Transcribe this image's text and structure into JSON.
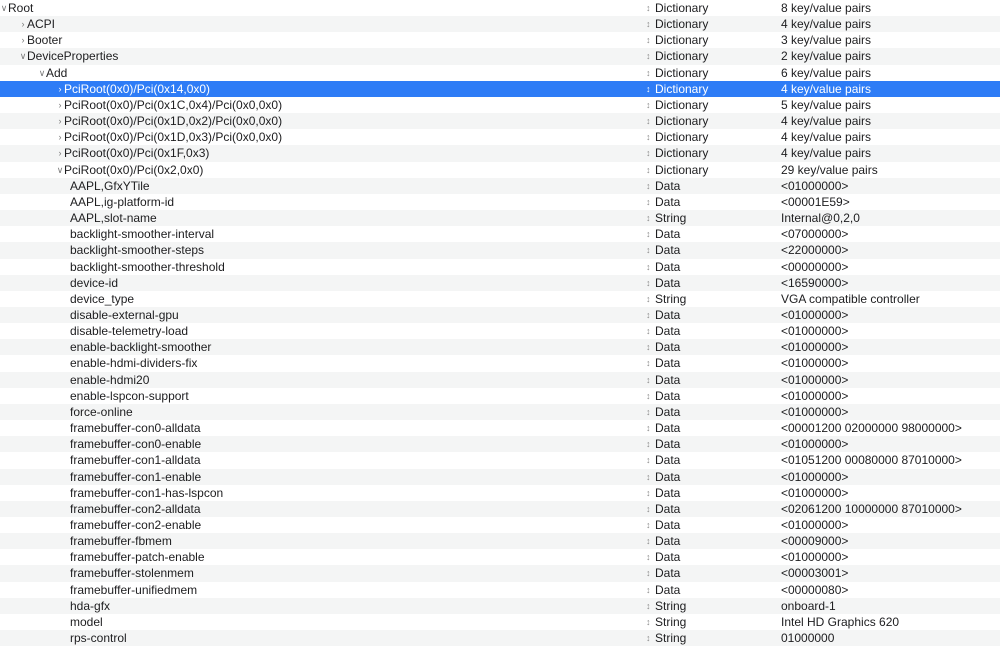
{
  "icons": {
    "expanded": "chevron-down-icon",
    "collapsed": "chevron-right-icon",
    "type_selector": "up-down-arrows-icon"
  },
  "colors": {
    "selection": "#2e7cf6",
    "alternate_row": "#f4f5f5"
  },
  "rows": [
    {
      "level": 0,
      "disclosure": "expanded",
      "key": "Root",
      "type": "Dictionary",
      "value": "8 key/value pairs"
    },
    {
      "level": 1,
      "disclosure": "collapsed",
      "key": "ACPI",
      "type": "Dictionary",
      "value": "4 key/value pairs"
    },
    {
      "level": 1,
      "disclosure": "collapsed",
      "key": "Booter",
      "type": "Dictionary",
      "value": "3 key/value pairs"
    },
    {
      "level": 1,
      "disclosure": "expanded",
      "key": "DeviceProperties",
      "type": "Dictionary",
      "value": "2 key/value pairs"
    },
    {
      "level": 2,
      "disclosure": "expanded",
      "key": "Add",
      "type": "Dictionary",
      "value": "6 key/value pairs"
    },
    {
      "level": 3,
      "disclosure": "collapsed",
      "key": "PciRoot(0x0)/Pci(0x14,0x0)",
      "type": "Dictionary",
      "value": "4 key/value pairs",
      "selected": true
    },
    {
      "level": 3,
      "disclosure": "collapsed",
      "key": "PciRoot(0x0)/Pci(0x1C,0x4)/Pci(0x0,0x0)",
      "type": "Dictionary",
      "value": "5 key/value pairs"
    },
    {
      "level": 3,
      "disclosure": "collapsed",
      "key": "PciRoot(0x0)/Pci(0x1D,0x2)/Pci(0x0,0x0)",
      "type": "Dictionary",
      "value": "4 key/value pairs"
    },
    {
      "level": 3,
      "disclosure": "collapsed",
      "key": "PciRoot(0x0)/Pci(0x1D,0x3)/Pci(0x0,0x0)",
      "type": "Dictionary",
      "value": "4 key/value pairs"
    },
    {
      "level": 3,
      "disclosure": "collapsed",
      "key": "PciRoot(0x0)/Pci(0x1F,0x3)",
      "type": "Dictionary",
      "value": "4 key/value pairs"
    },
    {
      "level": 3,
      "disclosure": "expanded",
      "key": "PciRoot(0x0)/Pci(0x2,0x0)",
      "type": "Dictionary",
      "value": "29 key/value pairs"
    },
    {
      "level": 4,
      "key": "AAPL,GfxYTile",
      "type": "Data",
      "value": "<01000000>"
    },
    {
      "level": 4,
      "key": "AAPL,ig-platform-id",
      "type": "Data",
      "value": "<00001E59>"
    },
    {
      "level": 4,
      "key": "AAPL,slot-name",
      "type": "String",
      "value": "Internal@0,2,0"
    },
    {
      "level": 4,
      "key": "backlight-smoother-interval",
      "type": "Data",
      "value": "<07000000>"
    },
    {
      "level": 4,
      "key": "backlight-smoother-steps",
      "type": "Data",
      "value": "<22000000>"
    },
    {
      "level": 4,
      "key": "backlight-smoother-threshold",
      "type": "Data",
      "value": "<00000000>"
    },
    {
      "level": 4,
      "key": "device-id",
      "type": "Data",
      "value": "<16590000>"
    },
    {
      "level": 4,
      "key": "device_type",
      "type": "String",
      "value": "VGA compatible controller"
    },
    {
      "level": 4,
      "key": "disable-external-gpu",
      "type": "Data",
      "value": "<01000000>"
    },
    {
      "level": 4,
      "key": "disable-telemetry-load",
      "type": "Data",
      "value": "<01000000>"
    },
    {
      "level": 4,
      "key": "enable-backlight-smoother",
      "type": "Data",
      "value": "<01000000>"
    },
    {
      "level": 4,
      "key": "enable-hdmi-dividers-fix",
      "type": "Data",
      "value": "<01000000>"
    },
    {
      "level": 4,
      "key": "enable-hdmi20",
      "type": "Data",
      "value": "<01000000>"
    },
    {
      "level": 4,
      "key": "enable-lspcon-support",
      "type": "Data",
      "value": "<01000000>"
    },
    {
      "level": 4,
      "key": "force-online",
      "type": "Data",
      "value": "<01000000>"
    },
    {
      "level": 4,
      "key": "framebuffer-con0-alldata",
      "type": "Data",
      "value": "<00001200 02000000 98000000>"
    },
    {
      "level": 4,
      "key": "framebuffer-con0-enable",
      "type": "Data",
      "value": "<01000000>"
    },
    {
      "level": 4,
      "key": "framebuffer-con1-alldata",
      "type": "Data",
      "value": "<01051200 00080000 87010000>"
    },
    {
      "level": 4,
      "key": "framebuffer-con1-enable",
      "type": "Data",
      "value": "<01000000>"
    },
    {
      "level": 4,
      "key": "framebuffer-con1-has-lspcon",
      "type": "Data",
      "value": "<01000000>"
    },
    {
      "level": 4,
      "key": "framebuffer-con2-alldata",
      "type": "Data",
      "value": "<02061200 10000000 87010000>"
    },
    {
      "level": 4,
      "key": "framebuffer-con2-enable",
      "type": "Data",
      "value": "<01000000>"
    },
    {
      "level": 4,
      "key": "framebuffer-fbmem",
      "type": "Data",
      "value": "<00009000>"
    },
    {
      "level": 4,
      "key": "framebuffer-patch-enable",
      "type": "Data",
      "value": "<01000000>"
    },
    {
      "level": 4,
      "key": "framebuffer-stolenmem",
      "type": "Data",
      "value": "<00003001>"
    },
    {
      "level": 4,
      "key": "framebuffer-unifiedmem",
      "type": "Data",
      "value": "<00000080>"
    },
    {
      "level": 4,
      "key": "hda-gfx",
      "type": "String",
      "value": "onboard-1"
    },
    {
      "level": 4,
      "key": "model",
      "type": "String",
      "value": "Intel HD Graphics 620"
    },
    {
      "level": 4,
      "key": "rps-control",
      "type": "String",
      "value": "01000000"
    }
  ]
}
